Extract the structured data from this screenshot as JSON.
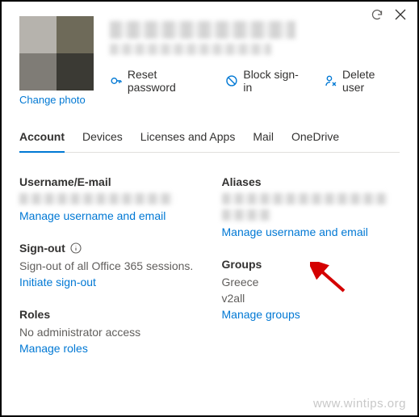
{
  "topbar": {
    "refresh_name": "refresh-icon",
    "close_name": "close-icon"
  },
  "header": {
    "change_photo": "Change photo"
  },
  "actions": {
    "reset_password": "Reset password",
    "block_signin": "Block sign-in",
    "delete_user": "Delete user"
  },
  "tabs": {
    "account": "Account",
    "devices": "Devices",
    "licenses": "Licenses and Apps",
    "mail": "Mail",
    "onedrive": "OneDrive"
  },
  "left": {
    "username_h": "Username/E-mail",
    "manage_username": "Manage username and email",
    "signout_h": "Sign-out",
    "signout_desc": "Sign-out of all Office 365 sessions.",
    "initiate_signout": "Initiate sign-out",
    "roles_h": "Roles",
    "roles_desc": "No administrator access",
    "manage_roles": "Manage roles"
  },
  "right": {
    "aliases_h": "Aliases",
    "manage_username": "Manage username and email",
    "groups_h": "Groups",
    "group1": "Greece",
    "group2": "v2all",
    "manage_groups": "Manage groups"
  },
  "watermark": "www.wintips.org"
}
